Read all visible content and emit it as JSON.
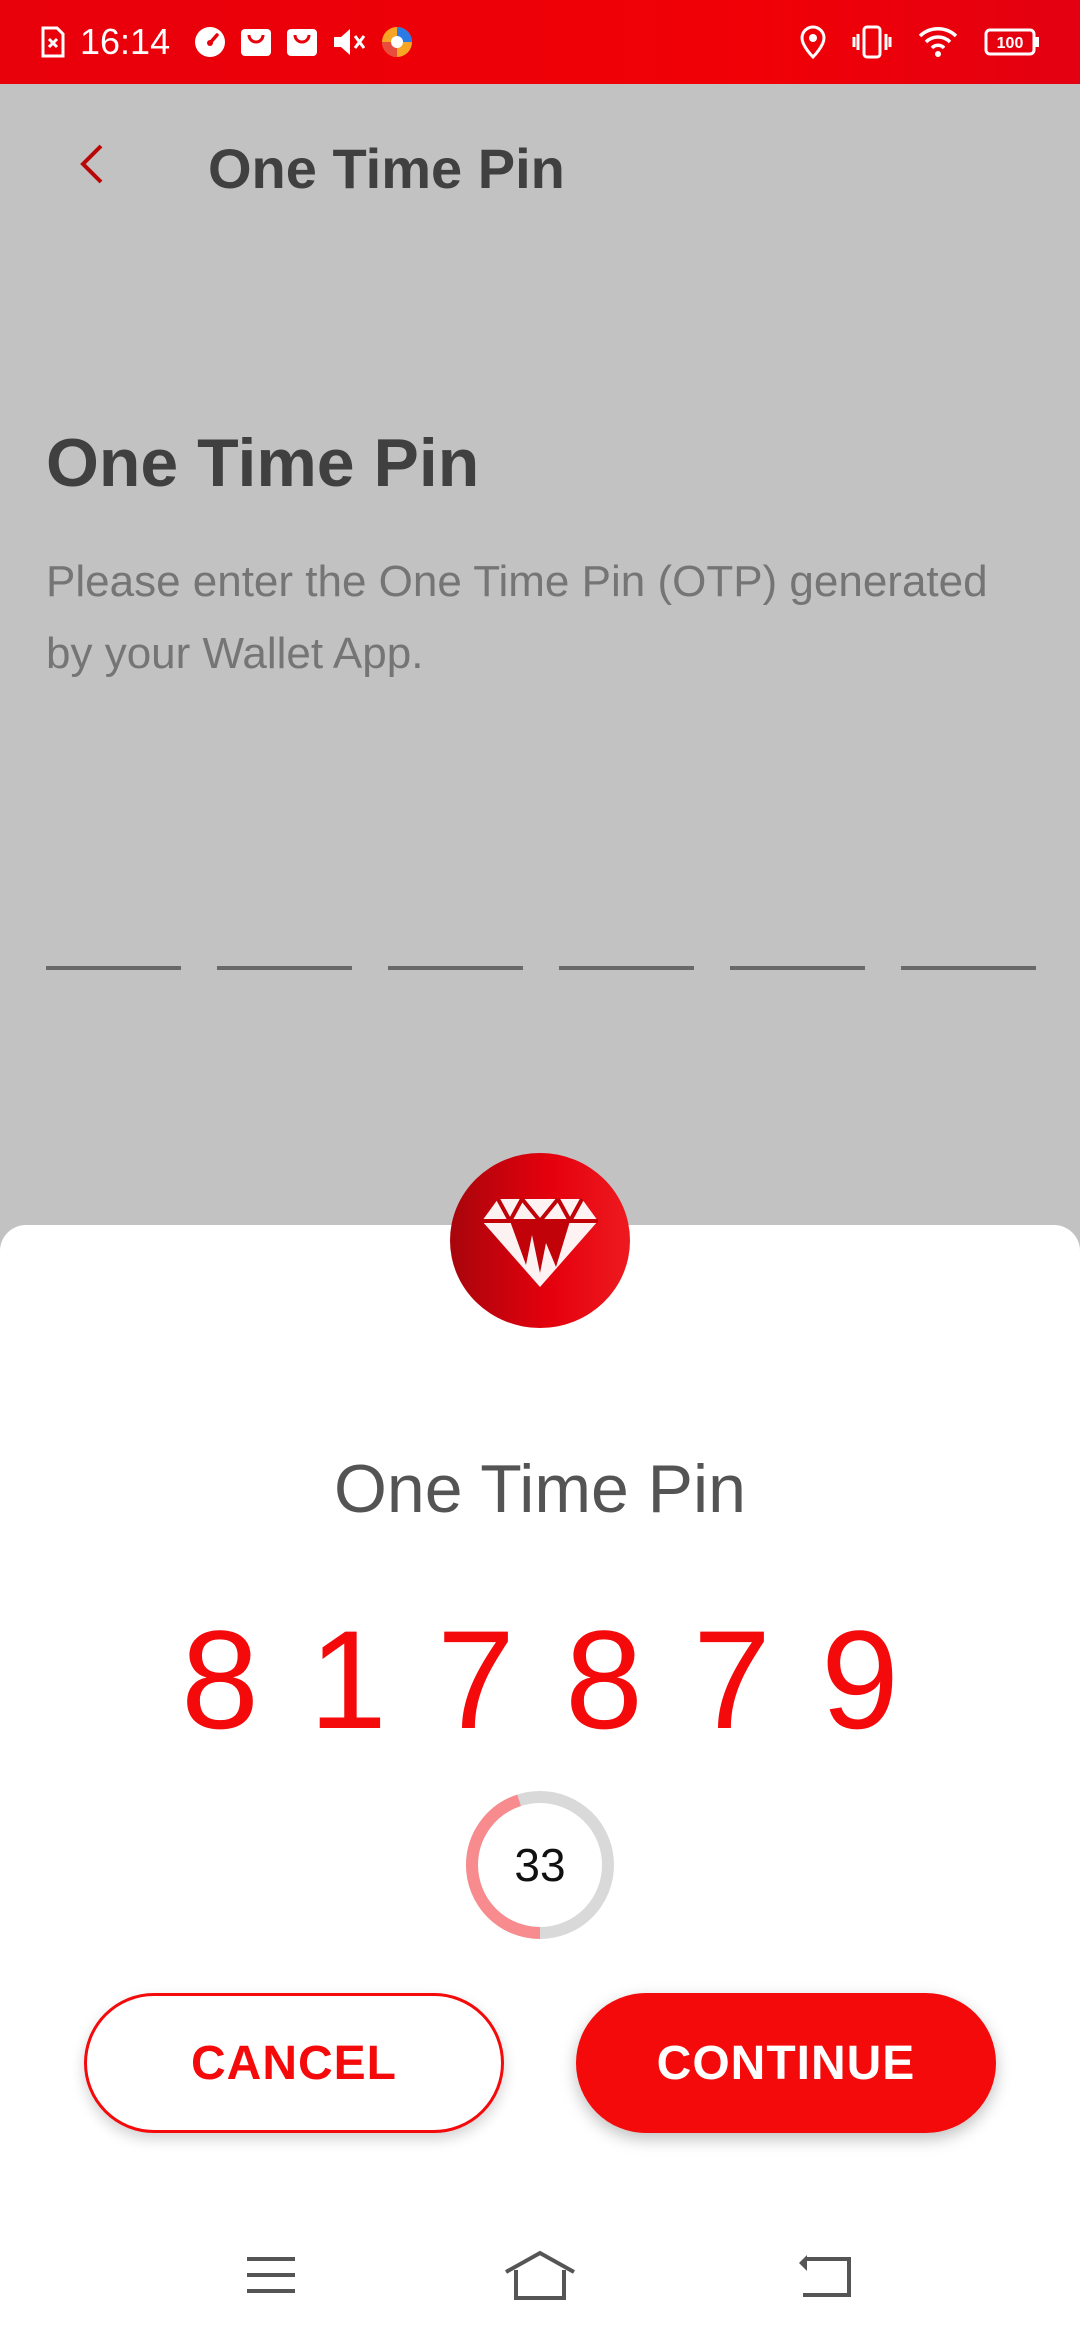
{
  "status_bar": {
    "time": "16:14",
    "battery_level": "100",
    "icons": [
      "sim-error-icon",
      "speedometer-icon",
      "shopping-bag-icon",
      "shopping-bag-icon",
      "mute-icon",
      "browser-icon",
      "location-icon",
      "vibrate-icon",
      "wifi-icon",
      "battery-icon"
    ]
  },
  "header": {
    "title": "One Time Pin"
  },
  "page": {
    "title": "One Time Pin",
    "description": "Please enter the One Time Pin (OTP) generated by your Wallet App."
  },
  "dialog": {
    "title": "One Time Pin",
    "otp_digits": [
      "8",
      "1",
      "7",
      "8",
      "7",
      "9"
    ],
    "countdown": "33",
    "countdown_progress_fraction": 0.45,
    "cancel_label": "CANCEL",
    "continue_label": "CONTINUE"
  },
  "colors": {
    "accent": "#f40a0a",
    "status_bar": "#ee0008",
    "timer_track": "#d9d9d9",
    "timer_progress": "#f88b8e"
  }
}
